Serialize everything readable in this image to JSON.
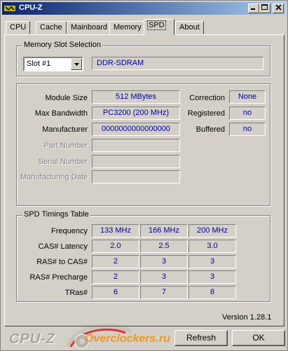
{
  "window": {
    "title": "CPU-Z"
  },
  "tabs": [
    "CPU",
    "Cache",
    "Mainboard",
    "Memory",
    "SPD",
    "About"
  ],
  "active_tab": "SPD",
  "slot_group": {
    "title": "Memory Slot Selection",
    "selected": "Slot #1",
    "memory_type": "DDR-SDRAM"
  },
  "module": {
    "module_size_label": "Module Size",
    "module_size": "512 MBytes",
    "max_bandwidth_label": "Max Bandwidth",
    "max_bandwidth": "PC3200 (200 MHz)",
    "manufacturer_label": "Manufacturer",
    "manufacturer": "0000000000000000",
    "part_number_label": "Part Number",
    "serial_number_label": "Serial Number",
    "manufacturing_date_label": "Manufacturing Date",
    "correction_label": "Correction",
    "correction": "None",
    "registered_label": "Registered",
    "registered": "no",
    "buffered_label": "Buffered",
    "buffered": "no"
  },
  "timings": {
    "title": "SPD Timings Table",
    "rows": [
      {
        "label": "Frequency",
        "values": [
          "133 MHz",
          "166 MHz",
          "200 MHz"
        ]
      },
      {
        "label": "CAS# Latency",
        "values": [
          "2.0",
          "2.5",
          "3.0"
        ]
      },
      {
        "label": "RAS# to CAS#",
        "values": [
          "2",
          "3",
          "3"
        ]
      },
      {
        "label": "RAS# Precharge",
        "values": [
          "2",
          "3",
          "3"
        ]
      },
      {
        "label": "TRas#",
        "values": [
          "6",
          "7",
          "8"
        ]
      }
    ]
  },
  "footer": {
    "version": "Version 1.28.1",
    "brand": "CPU-Z",
    "logo_text": "Overclockers.ru",
    "refresh_label": "Refresh",
    "ok_label": "OK"
  }
}
